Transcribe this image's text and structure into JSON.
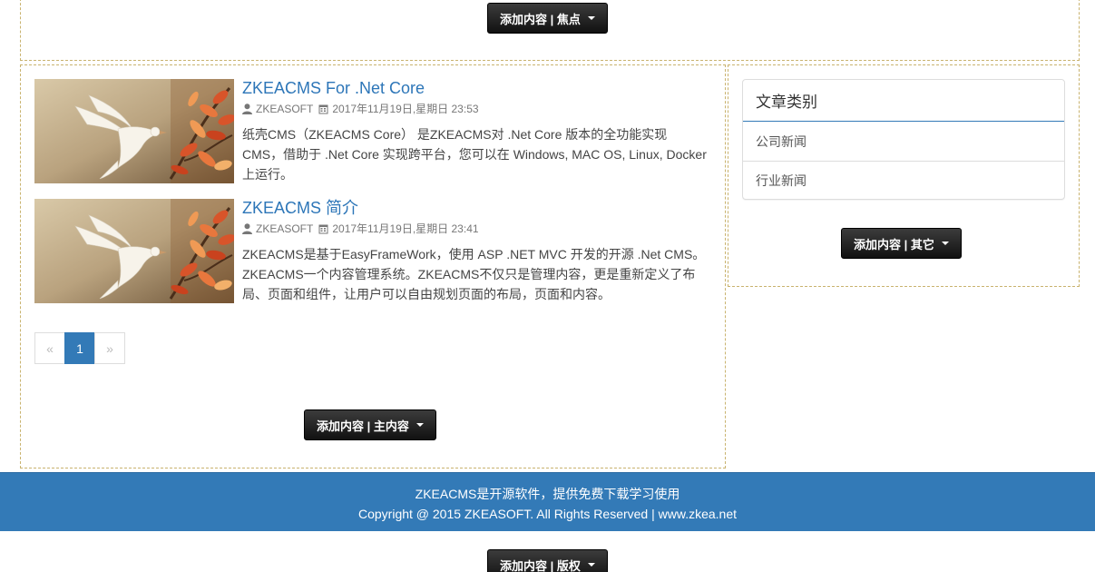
{
  "buttons": {
    "focus": "添加内容 | 焦点",
    "main": "添加内容 | 主内容",
    "other": "添加内容 | 其它",
    "copyright": "添加内容 | 版权"
  },
  "articles": [
    {
      "title": "ZKEACMS For .Net Core",
      "author": "ZKEASOFT",
      "date": "2017年11月19日,星期日 23:53",
      "summary": "纸壳CMS（ZKEACMS Core） 是ZKEACMS对 .Net Core 版本的全功能实现CMS，借助于 .Net Core 实现跨平台，您可以在 Windows, MAC OS, Linux, Docker 上运行。"
    },
    {
      "title": "ZKEACMS 简介",
      "author": "ZKEASOFT",
      "date": "2017年11月19日,星期日 23:41",
      "summary": "ZKEACMS是基于EasyFrameWork，使用 ASP .NET MVC 开发的开源 .Net CMS。 ZKEACMS一个内容管理系统。ZKEACMS不仅只是管理内容，更是重新定义了布局、页面和组件，让用户可以自由规划页面的布局，页面和内容。"
    }
  ],
  "pagination": {
    "prev": "«",
    "current": "1",
    "next": "»"
  },
  "category_panel": {
    "title": "文章类别",
    "items": [
      "公司新闻",
      "行业新闻"
    ]
  },
  "footer": {
    "line1": "ZKEACMS是开源软件，提供免费下载学习使用",
    "line2": "Copyright @ 2015 ZKEASOFT. All Rights Reserved | www.zkea.net"
  },
  "colors": {
    "accent": "#337ab7",
    "link": "#2d76b8",
    "zone_border": "#c9b36f",
    "button_bg": "#1a1a1a"
  },
  "icons": {
    "author": "user-icon",
    "date": "calendar-icon",
    "dropdown": "caret-down-icon",
    "thumbnail": "dove-with-autumn-leaves"
  }
}
